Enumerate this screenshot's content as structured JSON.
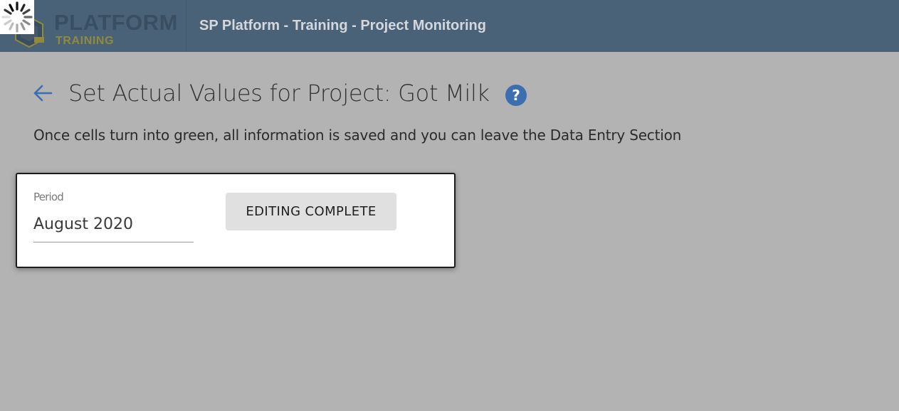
{
  "header": {
    "logo_text": "PLATFORM",
    "logo_subtext": "TRAINING",
    "app_title": "SP Platform - Training - Project Monitoring"
  },
  "page": {
    "title": "Set Actual Values for Project: Got Milk",
    "subtitle": "Once cells turn into green, all information is saved and you can leave the Data Entry Section"
  },
  "period_field": {
    "label": "Period",
    "value": "August 2020"
  },
  "actions": {
    "editing_complete_label": "EDITING COMPLETE"
  },
  "icons": {
    "back": "arrow-left-icon",
    "help": "question-circle-icon",
    "loading": "spinner-icon"
  },
  "colors": {
    "header_bg": "#4a6278",
    "accent_blue": "#3b6fb0",
    "page_bg": "#b3b3b3",
    "button_bg": "#e0e0e0"
  }
}
